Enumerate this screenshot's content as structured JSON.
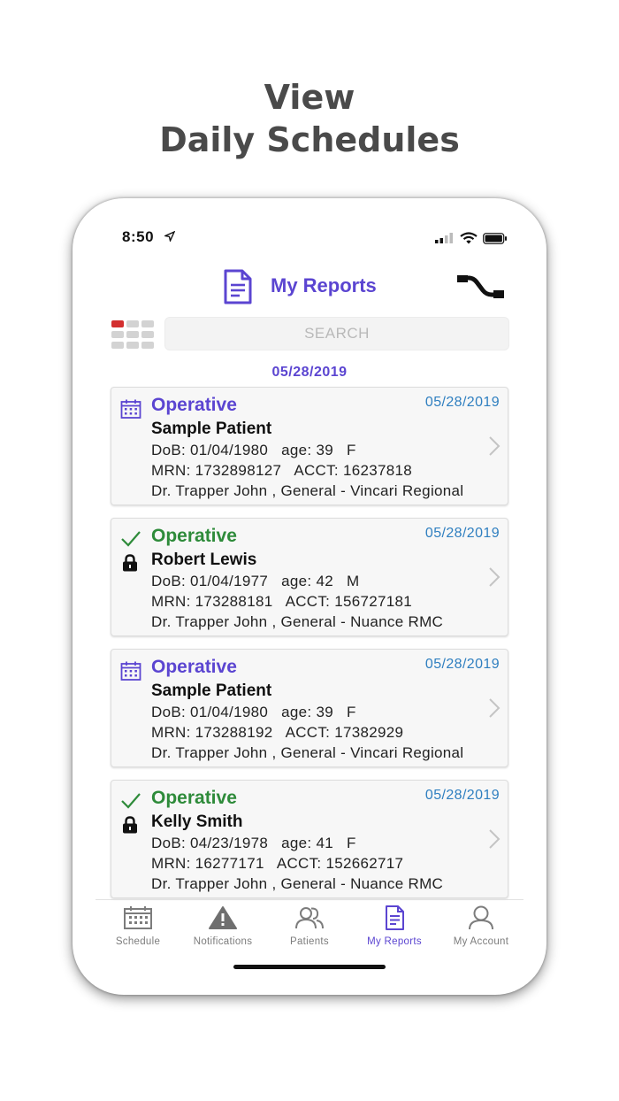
{
  "headline": {
    "line1": "View",
    "line2": "Daily Schedules"
  },
  "status_bar": {
    "time": "8:50"
  },
  "header": {
    "title": "My Reports",
    "icon": "document-icon",
    "action_icon": "swap-icon"
  },
  "search": {
    "placeholder": "SEARCH"
  },
  "date_header": "05/28/2019",
  "reports": [
    {
      "type": "Operative",
      "status_icon": "calendar-icon",
      "locked": false,
      "date": "05/28/2019",
      "patient": "Sample Patient",
      "dob_line": "DoB: 01/04/1980   age: 39   F",
      "ids_line": "MRN: 1732898127   ACCT: 16237818",
      "provider_line": "Dr. Trapper John , General - Vincari Regional"
    },
    {
      "type": "Operative",
      "status_icon": "check-icon",
      "locked": true,
      "date": "05/28/2019",
      "patient": "Robert Lewis",
      "dob_line": "DoB: 01/04/1977   age: 42   M",
      "ids_line": "MRN: 173288181   ACCT: 156727181",
      "provider_line": "Dr. Trapper John , General - Nuance RMC"
    },
    {
      "type": "Operative",
      "status_icon": "calendar-icon",
      "locked": false,
      "date": "05/28/2019",
      "patient": "Sample Patient",
      "dob_line": "DoB: 01/04/1980   age: 39   F",
      "ids_line": "MRN: 173288192   ACCT: 17382929",
      "provider_line": "Dr. Trapper John , General - Vincari Regional"
    },
    {
      "type": "Operative",
      "status_icon": "check-icon",
      "locked": true,
      "date": "05/28/2019",
      "patient": "Kelly Smith",
      "dob_line": "DoB: 04/23/1978   age: 41   F",
      "ids_line": "MRN: 16277171   ACCT: 152662717",
      "provider_line": "Dr. Trapper John , General - Nuance RMC"
    }
  ],
  "tabs": [
    {
      "label": "Schedule",
      "icon": "calendar-icon",
      "active": false
    },
    {
      "label": "Notifications",
      "icon": "warning-icon",
      "active": false
    },
    {
      "label": "Patients",
      "icon": "users-icon",
      "active": false
    },
    {
      "label": "My Reports",
      "icon": "document-icon",
      "active": true
    },
    {
      "label": "My Account",
      "icon": "user-icon",
      "active": false
    }
  ],
  "colors": {
    "accent": "#5b45d1",
    "success": "#2e8b3a",
    "date_blue": "#2f7fc0",
    "headline": "#4a4a4a"
  }
}
